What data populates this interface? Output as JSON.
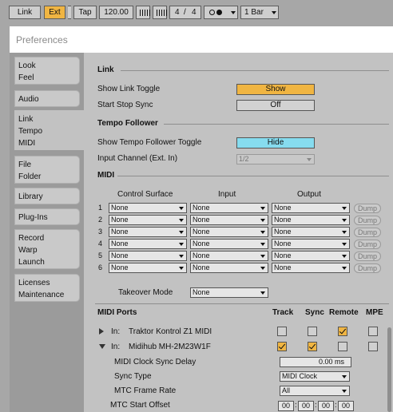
{
  "control_bar": {
    "link": "Link",
    "ext": "Ext",
    "tap": "Tap",
    "tempo": "120.00",
    "signature_num": "4",
    "signature_sep": "/",
    "signature_den": "4",
    "quantization": "1 Bar"
  },
  "window": {
    "title": "Preferences"
  },
  "tabs": [
    {
      "lines": [
        "Look",
        "Feel"
      ]
    },
    {
      "lines": [
        "Audio"
      ]
    },
    {
      "lines": [
        "Link",
        "Tempo",
        "MIDI"
      ],
      "active": true
    },
    {
      "lines": [
        "File",
        "Folder"
      ]
    },
    {
      "lines": [
        "Library"
      ]
    },
    {
      "lines": [
        "Plug-Ins"
      ]
    },
    {
      "lines": [
        "Record",
        "Warp",
        "Launch"
      ]
    },
    {
      "lines": [
        "Licenses",
        "Maintenance"
      ]
    }
  ],
  "link_section": {
    "title": "Link",
    "show_link_toggle_label": "Show Link Toggle",
    "show_link_toggle_value": "Show",
    "start_stop_sync_label": "Start Stop Sync",
    "start_stop_sync_value": "Off"
  },
  "tempo_follower": {
    "title": "Tempo Follower",
    "toggle_label": "Show Tempo Follower Toggle",
    "toggle_value": "Hide",
    "input_channel_label": "Input Channel (Ext. In)",
    "input_channel_value": "1/2"
  },
  "midi": {
    "title": "MIDI",
    "col_control_surface": "Control Surface",
    "col_input": "Input",
    "col_output": "Output",
    "dump_label": "Dump",
    "rows": [
      {
        "num": "1",
        "control_surface": "None",
        "input": "None",
        "output": "None"
      },
      {
        "num": "2",
        "control_surface": "None",
        "input": "None",
        "output": "None"
      },
      {
        "num": "3",
        "control_surface": "None",
        "input": "None",
        "output": "None"
      },
      {
        "num": "4",
        "control_surface": "None",
        "input": "None",
        "output": "None"
      },
      {
        "num": "5",
        "control_surface": "None",
        "input": "None",
        "output": "None"
      },
      {
        "num": "6",
        "control_surface": "None",
        "input": "None",
        "output": "None"
      }
    ],
    "takeover_mode_label": "Takeover Mode",
    "takeover_mode_value": "None"
  },
  "midi_ports": {
    "title": "MIDI Ports",
    "col_track": "Track",
    "col_sync": "Sync",
    "col_remote": "Remote",
    "col_mpe": "MPE",
    "ports": [
      {
        "direction": "In:",
        "name": "Traktor Kontrol Z1 MIDI",
        "expanded": false,
        "track": false,
        "sync": false,
        "remote": true,
        "mpe": false
      },
      {
        "direction": "In:",
        "name": "Midihub MH-2M23W1F",
        "expanded": true,
        "track": true,
        "sync": true,
        "remote": false,
        "mpe": false
      }
    ],
    "clock_sync_delay_label": "MIDI Clock Sync Delay",
    "clock_sync_delay_value": "0.00 ms",
    "sync_type_label": "Sync Type",
    "sync_type_value": "MIDI Clock",
    "mtc_frame_rate_label": "MTC Frame Rate",
    "mtc_frame_rate_value": "All",
    "mtc_start_offset_label": "MTC Start Offset",
    "mtc_start_offset_values": [
      "00",
      "00",
      "00",
      "00"
    ]
  },
  "colors": {
    "accent_orange": "#f0b542",
    "accent_cyan": "#86dcef",
    "panel_bg": "#c2c2c2",
    "chrome_bg": "#a7a7a7"
  }
}
